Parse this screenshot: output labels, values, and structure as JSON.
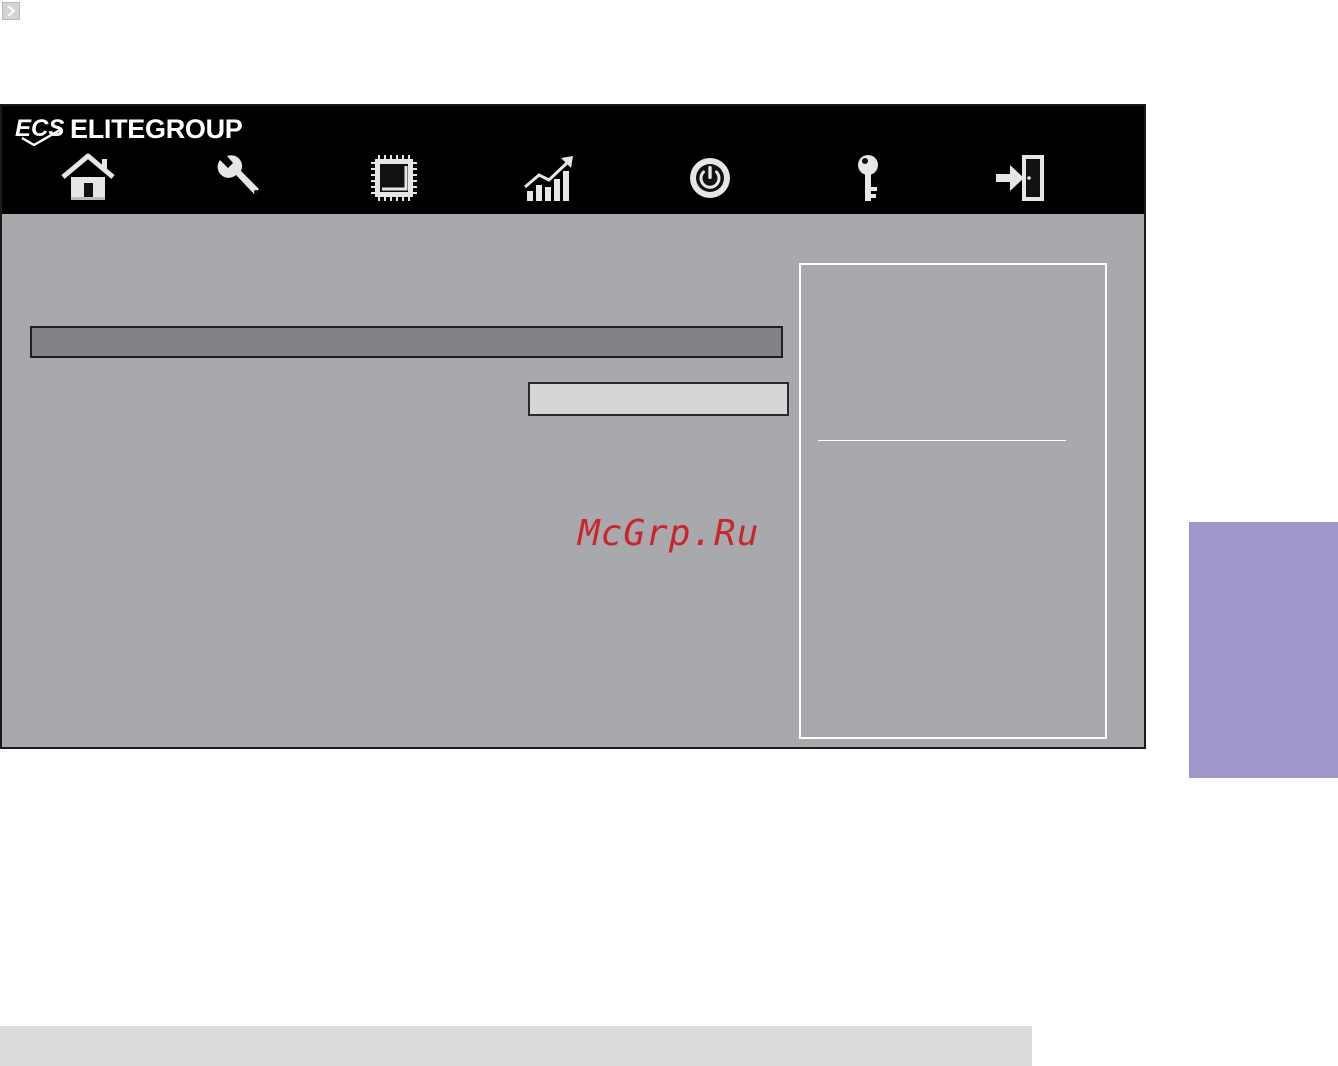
{
  "brand": {
    "logo_text": "ECS",
    "name": "ELITEGROUP"
  },
  "nav": {
    "items": [
      {
        "icon": "home-icon"
      },
      {
        "icon": "wrench-icon"
      },
      {
        "icon": "chip-icon"
      },
      {
        "icon": "performance-chart-icon"
      },
      {
        "icon": "power-icon"
      },
      {
        "icon": "key-icon"
      },
      {
        "icon": "exit-icon"
      }
    ]
  },
  "main": {
    "section_bar_label": "",
    "setting_value": ""
  },
  "watermark": {
    "text": "McGrp.Ru"
  },
  "colors": {
    "header_bg": "#000000",
    "body_bg": "#a8a9ad",
    "section_bar": "#828387",
    "value_box": "#d6d6d8",
    "help_border": "#ffffff",
    "side_tab": "#9e97cb",
    "watermark": "#c9262c",
    "footer_strip": "#dcdcde"
  }
}
